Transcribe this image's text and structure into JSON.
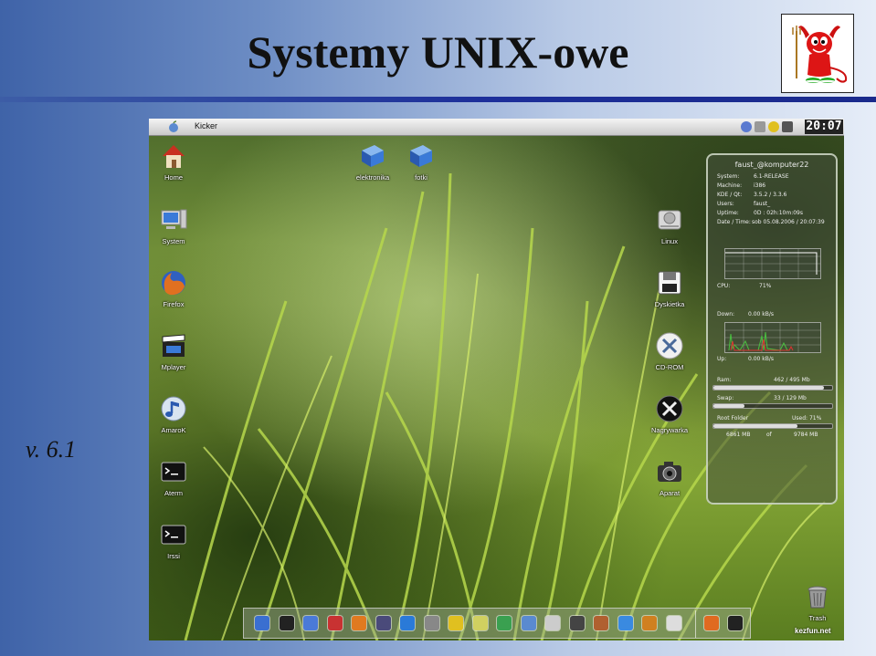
{
  "slide": {
    "title": "Systemy UNIX-owe",
    "version": "v. 6.1"
  },
  "kicker": {
    "label": "Kicker",
    "clock": "20:07",
    "tray_icons": [
      "network-icon",
      "tools-icon",
      "weather-icon",
      "music-icon"
    ]
  },
  "desktop": {
    "left_icons": [
      {
        "label": "Home",
        "icon": "home-icon"
      },
      {
        "label": "System",
        "icon": "computer-icon"
      },
      {
        "label": "Firefox",
        "icon": "firefox-icon"
      },
      {
        "label": "Mplayer",
        "icon": "clapperboard-icon"
      },
      {
        "label": "AmaroK",
        "icon": "music-note-icon"
      },
      {
        "label": "Aterm",
        "icon": "terminal-icon"
      },
      {
        "label": "Irssi",
        "icon": "terminal-icon"
      }
    ],
    "top_icons": [
      {
        "label": "elektronika",
        "icon": "book-icon"
      },
      {
        "label": "fotki",
        "icon": "book-icon"
      }
    ],
    "right_icons": [
      {
        "label": "Linux",
        "icon": "hard-drive-icon"
      },
      {
        "label": "Dyskietka",
        "icon": "floppy-icon"
      },
      {
        "label": "CD-ROM",
        "icon": "cd-icon"
      },
      {
        "label": "Nagrywarka",
        "icon": "burner-icon"
      },
      {
        "label": "Aparat",
        "icon": "camera-icon"
      }
    ],
    "trash": {
      "label": "Trash",
      "icon": "trash-icon"
    },
    "watermark": "kezfun.net"
  },
  "sysmon": {
    "header": "faust_@komputer22",
    "rows": [
      {
        "k": "System:",
        "v": "6.1-RELEASE"
      },
      {
        "k": "Machine:",
        "v": "i386"
      },
      {
        "k": "KDE / Qt:",
        "v": "3.5.2  /  3.3.6"
      },
      {
        "k": "Users:",
        "v": "faust_"
      },
      {
        "k": "Uptime:",
        "v": "0D : 02h:10m:09s"
      },
      {
        "k": "Date / Time:",
        "v": "sob 05.08.2006 / 20:07:39"
      }
    ],
    "cpu": {
      "label": "CPU:",
      "value": "71%"
    },
    "down": {
      "label": "Down:",
      "value": "0.00 kB/s"
    },
    "up": {
      "label": "Up:",
      "value": "0.00 kB/s"
    },
    "ram": {
      "label": "Ram:",
      "value": "462 / 495 Mb",
      "fraction": 0.93
    },
    "swap": {
      "label": "Swap:",
      "value": "33 / 129 Mb",
      "fraction": 0.26
    },
    "root": {
      "label": "Root Folder",
      "used": "Used: 71%",
      "fraction": 0.71,
      "a": "6861 MB",
      "of": "of",
      "b": "9784 MB"
    }
  },
  "dock": {
    "apps": [
      {
        "icon": "film-icon",
        "color": "#3a6fd0"
      },
      {
        "icon": "terminal-icon",
        "color": "#222222"
      },
      {
        "icon": "windows-icon",
        "color": "#4a7ad8"
      },
      {
        "icon": "pdf-icon",
        "color": "#c83232"
      },
      {
        "icon": "firefox-icon",
        "color": "#e07a20"
      },
      {
        "icon": "image-icon",
        "color": "#4a4a7a"
      },
      {
        "icon": "download-icon",
        "color": "#2a7ad8"
      },
      {
        "icon": "settings-icon",
        "color": "#888888"
      },
      {
        "icon": "sun-icon",
        "color": "#e0c020"
      },
      {
        "icon": "sparkle-icon",
        "color": "#d0d060"
      },
      {
        "icon": "skype-icon",
        "color": "#3aa050"
      },
      {
        "icon": "globe-icon",
        "color": "#5a8ad0"
      },
      {
        "icon": "dvd-icon",
        "color": "#cccccc"
      },
      {
        "icon": "camera-icon",
        "color": "#444444"
      },
      {
        "icon": "photo-icon",
        "color": "#b06030"
      },
      {
        "icon": "browser-icon",
        "color": "#3a8ae0"
      },
      {
        "icon": "burner-icon",
        "color": "#d08020"
      },
      {
        "icon": "photo-viewer-icon",
        "color": "#dddddd"
      },
      {
        "icon": "firefox-icon",
        "color": "#e06a20"
      },
      {
        "icon": "terminal-icon",
        "color": "#222222"
      }
    ]
  }
}
